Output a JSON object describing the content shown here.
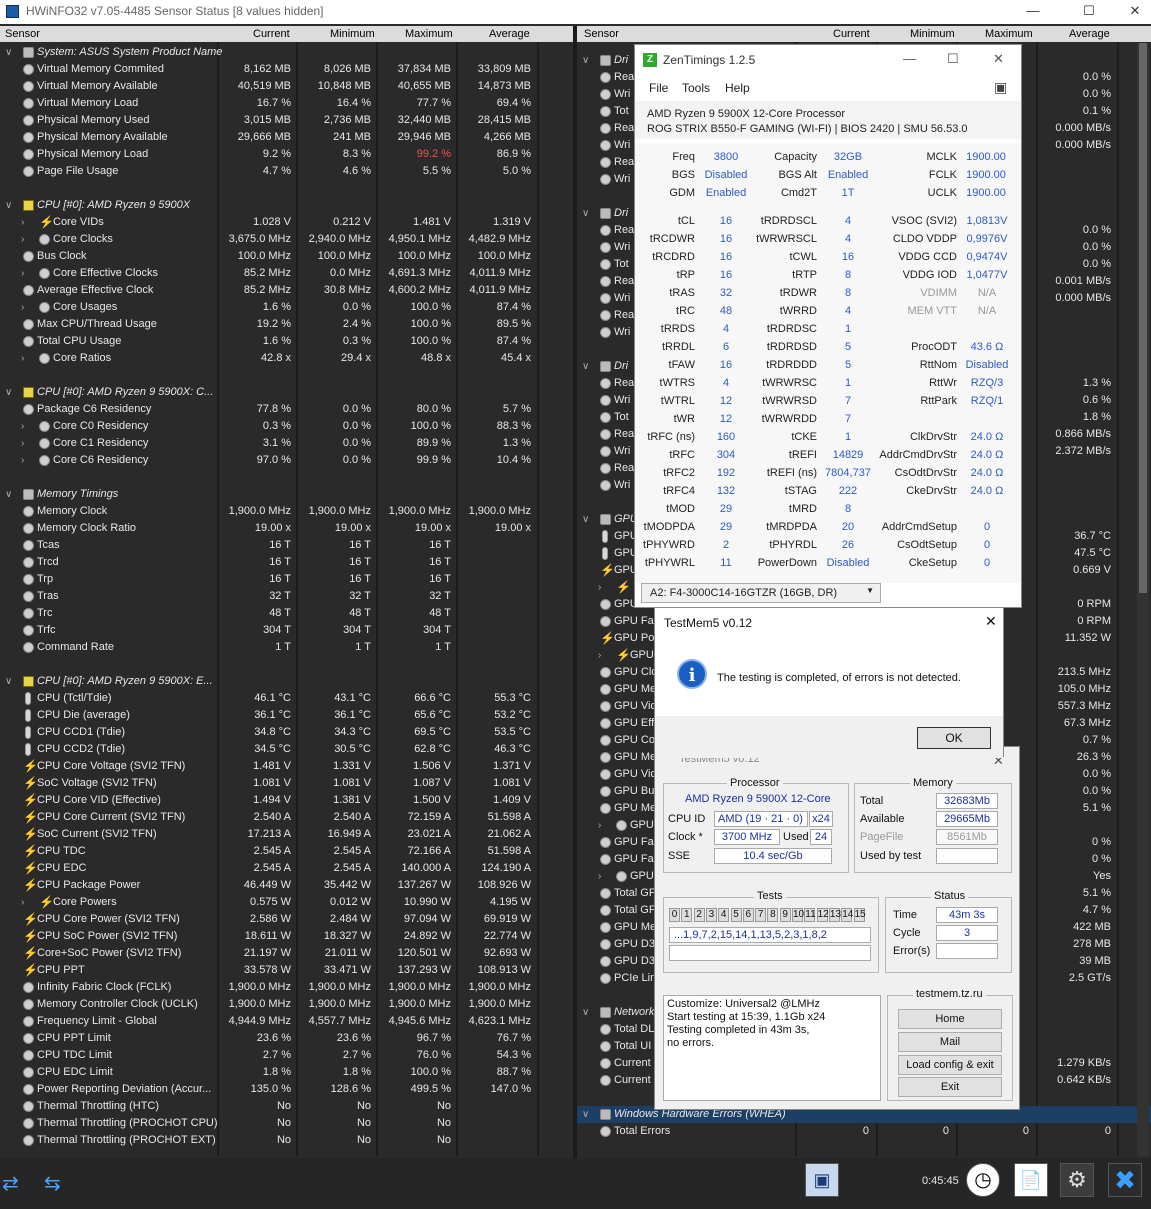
{
  "window": {
    "title": "HWiNFO32 v7.05-4485 Sensor Status [8 values hidden]"
  },
  "columns": {
    "sensor": "Sensor",
    "current": "Current",
    "minimum": "Minimum",
    "maximum": "Maximum",
    "average": "Average"
  },
  "left_rows": [
    {
      "t": "grp",
      "label": "System: ASUS System Product Name"
    },
    {
      "label": "Virtual Memory Commited",
      "c": "8,162 MB",
      "mn": "8,026 MB",
      "mx": "37,834 MB",
      "a": "33,809 MB"
    },
    {
      "label": "Virtual Memory Available",
      "c": "40,519 MB",
      "mn": "10,848 MB",
      "mx": "40,655 MB",
      "a": "14,873 MB"
    },
    {
      "label": "Virtual Memory Load",
      "c": "16.7 %",
      "mn": "16.4 %",
      "mx": "77.7 %",
      "a": "69.4 %"
    },
    {
      "label": "Physical Memory Used",
      "c": "3,015 MB",
      "mn": "2,736 MB",
      "mx": "32,440 MB",
      "a": "28,415 MB"
    },
    {
      "label": "Physical Memory Available",
      "c": "29,666 MB",
      "mn": "241 MB",
      "mx": "29,946 MB",
      "a": "4,266 MB"
    },
    {
      "label": "Physical Memory Load",
      "c": "9.2 %",
      "mn": "8.3 %",
      "mx": "99.2 %",
      "a": "86.9 %",
      "red": true
    },
    {
      "label": "Page File Usage",
      "c": "4.7 %",
      "mn": "4.6 %",
      "mx": "5.5 %",
      "a": "5.0 %"
    },
    {
      "t": "blank"
    },
    {
      "t": "grp",
      "label": "CPU [#0]: AMD Ryzen 9 5900X",
      "icon": "cpu"
    },
    {
      "t": "sub",
      "label": "Core VIDs",
      "icon": "bolt",
      "c": "1.028 V",
      "mn": "0.212 V",
      "mx": "1.481 V",
      "a": "1.319 V"
    },
    {
      "t": "sub",
      "label": "Core Clocks",
      "c": "3,675.0 MHz",
      "mn": "2,940.0 MHz",
      "mx": "4,950.1 MHz",
      "a": "4,482.9 MHz"
    },
    {
      "label": "Bus Clock",
      "c": "100.0 MHz",
      "mn": "100.0 MHz",
      "mx": "100.0 MHz",
      "a": "100.0 MHz"
    },
    {
      "t": "sub",
      "label": "Core Effective Clocks",
      "c": "85.2 MHz",
      "mn": "0.0 MHz",
      "mx": "4,691.3 MHz",
      "a": "4,011.9 MHz"
    },
    {
      "label": "Average Effective Clock",
      "c": "85.2 MHz",
      "mn": "30.8 MHz",
      "mx": "4,600.2 MHz",
      "a": "4,011.9 MHz"
    },
    {
      "t": "sub",
      "label": "Core Usages",
      "c": "1.6 %",
      "mn": "0.0 %",
      "mx": "100.0 %",
      "a": "87.4 %"
    },
    {
      "label": "Max CPU/Thread Usage",
      "c": "19.2 %",
      "mn": "2.4 %",
      "mx": "100.0 %",
      "a": "89.5 %"
    },
    {
      "label": "Total CPU Usage",
      "c": "1.6 %",
      "mn": "0.3 %",
      "mx": "100.0 %",
      "a": "87.4 %"
    },
    {
      "t": "sub",
      "label": "Core Ratios",
      "c": "42.8 x",
      "mn": "29.4 x",
      "mx": "48.8 x",
      "a": "45.4 x"
    },
    {
      "t": "blank"
    },
    {
      "t": "grp",
      "label": "CPU [#0]: AMD Ryzen 9 5900X: C...",
      "icon": "cpu"
    },
    {
      "label": "Package C6 Residency",
      "c": "77.8 %",
      "mn": "0.0 %",
      "mx": "80.0 %",
      "a": "5.7 %"
    },
    {
      "t": "sub",
      "label": "Core C0 Residency",
      "c": "0.3 %",
      "mn": "0.0 %",
      "mx": "100.0 %",
      "a": "88.3 %"
    },
    {
      "t": "sub",
      "label": "Core C1 Residency",
      "c": "3.1 %",
      "mn": "0.0 %",
      "mx": "89.9 %",
      "a": "1.3 %"
    },
    {
      "t": "sub",
      "label": "Core C6 Residency",
      "c": "97.0 %",
      "mn": "0.0 %",
      "mx": "99.9 %",
      "a": "10.4 %"
    },
    {
      "t": "blank"
    },
    {
      "t": "grp",
      "label": "Memory Timings"
    },
    {
      "label": "Memory Clock",
      "c": "1,900.0 MHz",
      "mn": "1,900.0 MHz",
      "mx": "1,900.0 MHz",
      "a": "1,900.0 MHz"
    },
    {
      "label": "Memory Clock Ratio",
      "c": "19.00 x",
      "mn": "19.00 x",
      "mx": "19.00 x",
      "a": "19.00 x"
    },
    {
      "label": "Tcas",
      "c": "16 T",
      "mn": "16 T",
      "mx": "16 T",
      "a": ""
    },
    {
      "label": "Trcd",
      "c": "16 T",
      "mn": "16 T",
      "mx": "16 T",
      "a": ""
    },
    {
      "label": "Trp",
      "c": "16 T",
      "mn": "16 T",
      "mx": "16 T",
      "a": ""
    },
    {
      "label": "Tras",
      "c": "32 T",
      "mn": "32 T",
      "mx": "32 T",
      "a": ""
    },
    {
      "label": "Trc",
      "c": "48 T",
      "mn": "48 T",
      "mx": "48 T",
      "a": ""
    },
    {
      "label": "Trfc",
      "c": "304 T",
      "mn": "304 T",
      "mx": "304 T",
      "a": ""
    },
    {
      "label": "Command Rate",
      "c": "1 T",
      "mn": "1 T",
      "mx": "1 T",
      "a": ""
    },
    {
      "t": "blank"
    },
    {
      "t": "grp",
      "label": "CPU [#0]: AMD Ryzen 9 5900X: E...",
      "icon": "cpu"
    },
    {
      "label": "CPU (Tctl/Tdie)",
      "icon": "therm",
      "c": "46.1 °C",
      "mn": "43.1 °C",
      "mx": "66.6 °C",
      "a": "55.3 °C"
    },
    {
      "label": "CPU Die (average)",
      "icon": "therm",
      "c": "36.1 °C",
      "mn": "36.1 °C",
      "mx": "65.6 °C",
      "a": "53.2 °C"
    },
    {
      "label": "CPU CCD1 (Tdie)",
      "icon": "therm",
      "c": "34.8 °C",
      "mn": "34.3 °C",
      "mx": "69.5 °C",
      "a": "53.5 °C"
    },
    {
      "label": "CPU CCD2 (Tdie)",
      "icon": "therm",
      "c": "34.5 °C",
      "mn": "30.5 °C",
      "mx": "62.8 °C",
      "a": "46.3 °C"
    },
    {
      "label": "CPU Core Voltage (SVI2 TFN)",
      "icon": "bolt",
      "c": "1.481 V",
      "mn": "1.331 V",
      "mx": "1.506 V",
      "a": "1.371 V"
    },
    {
      "label": "SoC Voltage (SVI2 TFN)",
      "icon": "bolt",
      "c": "1.081 V",
      "mn": "1.081 V",
      "mx": "1.087 V",
      "a": "1.081 V"
    },
    {
      "label": "CPU Core VID (Effective)",
      "icon": "bolt",
      "c": "1.494 V",
      "mn": "1.381 V",
      "mx": "1.500 V",
      "a": "1.409 V"
    },
    {
      "label": "CPU Core Current (SVI2 TFN)",
      "icon": "bolt",
      "c": "2.540 A",
      "mn": "2.540 A",
      "mx": "72.159 A",
      "a": "51.598 A"
    },
    {
      "label": "SoC Current (SVI2 TFN)",
      "icon": "bolt",
      "c": "17.213 A",
      "mn": "16.949 A",
      "mx": "23.021 A",
      "a": "21.062 A"
    },
    {
      "label": "CPU TDC",
      "icon": "bolt",
      "c": "2.545 A",
      "mn": "2.545 A",
      "mx": "72.166 A",
      "a": "51.598 A"
    },
    {
      "label": "CPU EDC",
      "icon": "bolt",
      "c": "2.545 A",
      "mn": "2.545 A",
      "mx": "140.000 A",
      "a": "124.190 A"
    },
    {
      "label": "CPU Package Power",
      "icon": "bolt",
      "c": "46.449 W",
      "mn": "35.442 W",
      "mx": "137.267 W",
      "a": "108.926 W"
    },
    {
      "t": "sub",
      "label": "Core Powers",
      "icon": "bolt",
      "c": "0.575 W",
      "mn": "0.012 W",
      "mx": "10.990 W",
      "a": "4.195 W"
    },
    {
      "label": "CPU Core Power (SVI2 TFN)",
      "icon": "bolt",
      "c": "2.586 W",
      "mn": "2.484 W",
      "mx": "97.094 W",
      "a": "69.919 W"
    },
    {
      "label": "CPU SoC Power (SVI2 TFN)",
      "icon": "bolt",
      "c": "18.611 W",
      "mn": "18.327 W",
      "mx": "24.892 W",
      "a": "22.774 W"
    },
    {
      "label": "Core+SoC Power (SVI2 TFN)",
      "icon": "bolt",
      "c": "21.197 W",
      "mn": "21.011 W",
      "mx": "120.501 W",
      "a": "92.693 W"
    },
    {
      "label": "CPU PPT",
      "icon": "bolt",
      "c": "33.578 W",
      "mn": "33.471 W",
      "mx": "137.293 W",
      "a": "108.913 W"
    },
    {
      "label": "Infinity Fabric Clock (FCLK)",
      "c": "1,900.0 MHz",
      "mn": "1,900.0 MHz",
      "mx": "1,900.0 MHz",
      "a": "1,900.0 MHz"
    },
    {
      "label": "Memory Controller Clock (UCLK)",
      "c": "1,900.0 MHz",
      "mn": "1,900.0 MHz",
      "mx": "1,900.0 MHz",
      "a": "1,900.0 MHz"
    },
    {
      "label": "Frequency Limit - Global",
      "c": "4,944.9 MHz",
      "mn": "4,557.7 MHz",
      "mx": "4,945.6 MHz",
      "a": "4,623.1 MHz"
    },
    {
      "label": "CPU PPT Limit",
      "c": "23.6 %",
      "mn": "23.6 %",
      "mx": "96.7 %",
      "a": "76.7 %"
    },
    {
      "label": "CPU TDC Limit",
      "c": "2.7 %",
      "mn": "2.7 %",
      "mx": "76.0 %",
      "a": "54.3 %"
    },
    {
      "label": "CPU EDC Limit",
      "c": "1.8 %",
      "mn": "1.8 %",
      "mx": "100.0 %",
      "a": "88.7 %"
    },
    {
      "label": "Power Reporting Deviation (Accur...",
      "c": "135.0 %",
      "mn": "128.6 %",
      "mx": "499.5 %",
      "a": "147.0 %"
    },
    {
      "label": "Thermal Throttling (HTC)",
      "c": "No",
      "mn": "No",
      "mx": "No",
      "a": ""
    },
    {
      "label": "Thermal Throttling (PROCHOT CPU)",
      "c": "No",
      "mn": "No",
      "mx": "No",
      "a": ""
    },
    {
      "label": "Thermal Throttling (PROCHOT EXT)",
      "c": "No",
      "mn": "No",
      "mx": "No",
      "a": ""
    }
  ],
  "right_rows": [
    {
      "t": "blank"
    },
    {
      "t": "grp",
      "label": "Dri"
    },
    {
      "label": "Rea",
      "c": "%",
      "a": "0.0 %"
    },
    {
      "label": "Wri",
      "c": "%",
      "a": "0.0 %"
    },
    {
      "label": "Tot",
      "c": "%",
      "a": "0.1 %"
    },
    {
      "label": "Rea",
      "c": "/s",
      "a": "0.000 MB/s"
    },
    {
      "label": "Wri",
      "c": "/s",
      "a": "0.000 MB/s"
    },
    {
      "label": "Rea",
      "c": "B",
      "a": ""
    },
    {
      "label": "Wri",
      "c": "B",
      "a": ""
    },
    {
      "t": "blank"
    },
    {
      "t": "grp",
      "label": "Dri"
    },
    {
      "label": "Rea",
      "c": "%",
      "a": "0.0 %"
    },
    {
      "label": "Wri",
      "c": "%",
      "a": "0.0 %"
    },
    {
      "label": "Tot",
      "c": "%",
      "a": "0.0 %"
    },
    {
      "label": "Rea",
      "c": "/s",
      "a": "0.001 MB/s"
    },
    {
      "label": "Wri",
      "c": "/s",
      "a": "0.000 MB/s"
    },
    {
      "label": "Rea",
      "c": "B",
      "a": ""
    },
    {
      "label": "Wri",
      "c": "B",
      "a": ""
    },
    {
      "t": "blank"
    },
    {
      "t": "grp",
      "label": "Dri"
    },
    {
      "label": "Rea",
      "c": "%",
      "a": "1.3 %"
    },
    {
      "label": "Wri",
      "c": "%",
      "a": "0.6 %"
    },
    {
      "label": "Tot",
      "c": "%",
      "a": "1.8 %"
    },
    {
      "label": "Rea",
      "c": "/s",
      "a": "0.866 MB/s"
    },
    {
      "label": "Wri",
      "c": "/s",
      "a": "2.372 MB/s"
    },
    {
      "label": "Rea",
      "c": "B",
      "a": ""
    },
    {
      "label": "Wri",
      "c": "B",
      "a": ""
    },
    {
      "t": "blank"
    },
    {
      "t": "grp",
      "label": "GPU"
    },
    {
      "label": "GPU",
      "icon": "therm",
      "c": "C",
      "a": "36.7 °C"
    },
    {
      "label": "GPU",
      "icon": "therm",
      "c": "C",
      "a": "47.5 °C"
    },
    {
      "label": "GPU",
      "icon": "bolt",
      "c": "V",
      "a": "0.669 V"
    },
    {
      "t": "sub",
      "label": "",
      "icon": "bolt",
      "c": "V",
      "a": ""
    },
    {
      "label": "GPU Fa",
      "c": "RPM",
      "a": "0 RPM"
    },
    {
      "label": "GPU Fa",
      "c": "RPM",
      "a": "0 RPM"
    },
    {
      "label": "GPU Pov",
      "icon": "bolt",
      "c": "38 W",
      "a": "11.352 W"
    },
    {
      "t": "sub",
      "label": "GPU",
      "icon": "bolt",
      "c": "47 W",
      "a": ""
    },
    {
      "label": "GPU Clo",
      "c": "MHz",
      "a": "213.5 MHz"
    },
    {
      "label": "GPU Me",
      "c": "MHz",
      "a": "105.0 MHz"
    },
    {
      "label": "GPU Vid",
      "c": "MHz",
      "a": "557.3 MHz"
    },
    {
      "label": "GPU Eff",
      "c": "MHz",
      "a": "67.3 MHz"
    },
    {
      "label": "GPU Co",
      "c": "%",
      "a": "0.7 %"
    },
    {
      "label": "GPU Me",
      "c": "%",
      "a": "26.3 %"
    },
    {
      "label": "GPU Vid",
      "c": "%",
      "a": "0.0 %"
    },
    {
      "label": "GPU Bu",
      "c": "%",
      "a": "0.0 %"
    },
    {
      "label": "GPU Me",
      "c": "%",
      "a": "5.1 %"
    },
    {
      "t": "sub",
      "label": "GPU",
      "c": "",
      "a": ""
    },
    {
      "label": "GPU Fa",
      "c": "%",
      "a": "0 %"
    },
    {
      "label": "GPU Fa",
      "c": "%",
      "a": "0 %"
    },
    {
      "t": "sub",
      "label": "GPU",
      "c": "es",
      "a": "Yes"
    },
    {
      "label": "Total GF",
      "c": "%",
      "a": "5.1 %"
    },
    {
      "label": "Total GF",
      "c": "%",
      "a": "4.7 %"
    },
    {
      "label": "GPU Me",
      "c": "MB",
      "a": "422 MB"
    },
    {
      "label": "GPU D3",
      "c": "MB",
      "a": "278 MB"
    },
    {
      "label": "GPU D3",
      "c": "MB",
      "a": "39 MB"
    },
    {
      "label": "PCIe Lin",
      "c": "/s",
      "a": "2.5 GT/s"
    },
    {
      "t": "blank"
    },
    {
      "t": "grp",
      "label": "Network"
    },
    {
      "label": "Total DL",
      "c": "MB",
      "a": ""
    },
    {
      "label": "Total UI",
      "c": "MB",
      "a": ""
    },
    {
      "label": "Current",
      "c": "/s",
      "a": "1.279 KB/s"
    },
    {
      "label": "Current",
      "c": "/s",
      "a": "0.642 KB/s"
    },
    {
      "t": "blank"
    },
    {
      "t": "grp",
      "label": "Windows Hardware Errors (WHEA)",
      "hl": true
    },
    {
      "label": "Total Errors",
      "c": "0",
      "mn": "0",
      "mx": "0",
      "a": "0"
    }
  ],
  "bottom": {
    "timer": "0:45:45"
  },
  "zen": {
    "title": "ZenTimings 1.2.5",
    "menu": [
      "File",
      "Tools",
      "Help"
    ],
    "cpu": "AMD Ryzen 9 5900X 12-Core Processor",
    "board": "ROG STRIX B550-F GAMING (WI-FI) | BIOS 2420 | SMU 56.53.0",
    "top": [
      [
        "Freq",
        "3800",
        "Capacity",
        "32GB",
        "MCLK",
        "1900.00"
      ],
      [
        "BGS",
        "Disabled",
        "BGS Alt",
        "Enabled",
        "FCLK",
        "1900.00"
      ],
      [
        "GDM",
        "Enabled",
        "Cmd2T",
        "1T",
        "UCLK",
        "1900.00"
      ]
    ],
    "rows": [
      [
        "tCL",
        "16",
        "tRDRDSCL",
        "4",
        "VSOC (SVI2)",
        "1,0813V"
      ],
      [
        "tRCDWR",
        "16",
        "tWRWRSCL",
        "4",
        "CLDO VDDP",
        "0,9976V"
      ],
      [
        "tRCDRD",
        "16",
        "tCWL",
        "16",
        "VDDG CCD",
        "0,9474V"
      ],
      [
        "tRP",
        "16",
        "tRTP",
        "8",
        "VDDG IOD",
        "1,0477V"
      ],
      [
        "tRAS",
        "32",
        "tRDWR",
        "8",
        "VDIMM",
        "N/A"
      ],
      [
        "tRC",
        "48",
        "tWRRD",
        "4",
        "MEM VTT",
        "N/A"
      ],
      [
        "tRRDS",
        "4",
        "tRDRDSC",
        "1",
        "",
        ""
      ],
      [
        "tRRDL",
        "6",
        "tRDRDSD",
        "5",
        "ProcODT",
        "43.6 Ω"
      ],
      [
        "tFAW",
        "16",
        "tRDRDDD",
        "5",
        "RttNom",
        "Disabled"
      ],
      [
        "tWTRS",
        "4",
        "tWRWRSC",
        "1",
        "RttWr",
        "RZQ/3"
      ],
      [
        "tWTRL",
        "12",
        "tWRWRSD",
        "7",
        "RttPark",
        "RZQ/1"
      ],
      [
        "tWR",
        "12",
        "tWRWRDD",
        "7",
        "",
        ""
      ],
      [
        "tRFC (ns)",
        "160",
        "tCKE",
        "1",
        "ClkDrvStr",
        "24.0 Ω"
      ],
      [
        "tRFC",
        "304",
        "tREFI",
        "14829",
        "AddrCmdDrvStr",
        "24.0 Ω"
      ],
      [
        "tRFC2",
        "192",
        "tREFI (ns)",
        "7804,737",
        "CsOdtDrvStr",
        "24.0 Ω"
      ],
      [
        "tRFC4",
        "132",
        "tSTAG",
        "222",
        "CkeDrvStr",
        "24.0 Ω"
      ],
      [
        "tMOD",
        "29",
        "tMRD",
        "8",
        "",
        ""
      ],
      [
        "tMODPDA",
        "29",
        "tMRDPDA",
        "20",
        "AddrCmdSetup",
        "0"
      ],
      [
        "tPHYWRD",
        "2",
        "tPHYRDL",
        "26",
        "CsOdtSetup",
        "0"
      ],
      [
        "tPHYWRL",
        "11",
        "PowerDown",
        "Disabled",
        "CkeSetup",
        "0"
      ]
    ],
    "module": "A2: F4-3000C14-16GTZR (16GB, DR)"
  },
  "tmdialog": {
    "title": "TestMem5 v0.12",
    "message": "The testing is completed, of errors is not detected.",
    "ok": "OK"
  },
  "tm": {
    "title": "TestMem5 v0.12",
    "processor_hdr": "Processor",
    "cpu": "AMD Ryzen 9 5900X 12-Core",
    "cpuid_lbl": "CPU ID",
    "cpuid": "AMD  (19 · 21 · 0)",
    "threads": "x24",
    "clock_lbl": "Clock *",
    "clock": "3700 MHz",
    "used_lbl": "Used",
    "used": "24",
    "sse_lbl": "SSE",
    "sse": "10.4 sec/Gb",
    "memory_hdr": "Memory",
    "total_lbl": "Total",
    "total": "32683Mb",
    "avail_lbl": "Available",
    "avail": "29665Mb",
    "pagefile_lbl": "PageFile",
    "pagefile": "8561Mb",
    "usedby_lbl": "Used by test",
    "usedby": "",
    "tests_hdr": "Tests",
    "test_nums": [
      "0",
      "1",
      "2",
      "3",
      "4",
      "5",
      "6",
      "7",
      "8",
      "9",
      "10",
      "11",
      "12",
      "13",
      "14",
      "15"
    ],
    "sequence": "...1,9,7,2,15,14,1,13,5,2,3,1,8,2",
    "status_hdr": "Status",
    "time_lbl": "Time",
    "time": "43m 3s",
    "cycle_lbl": "Cycle",
    "cycle": "3",
    "errors_lbl": "Error(s)",
    "errors": "",
    "log": [
      "Customize: Universal2 @LMHz",
      "Start testing at 15:39, 1.1Gb x24",
      "Testing completed in 43m 3s,",
      "no errors."
    ],
    "site": "testmem.tz.ru",
    "buttons": [
      "Home",
      "Mail",
      "Load config & exit",
      "Exit"
    ]
  }
}
